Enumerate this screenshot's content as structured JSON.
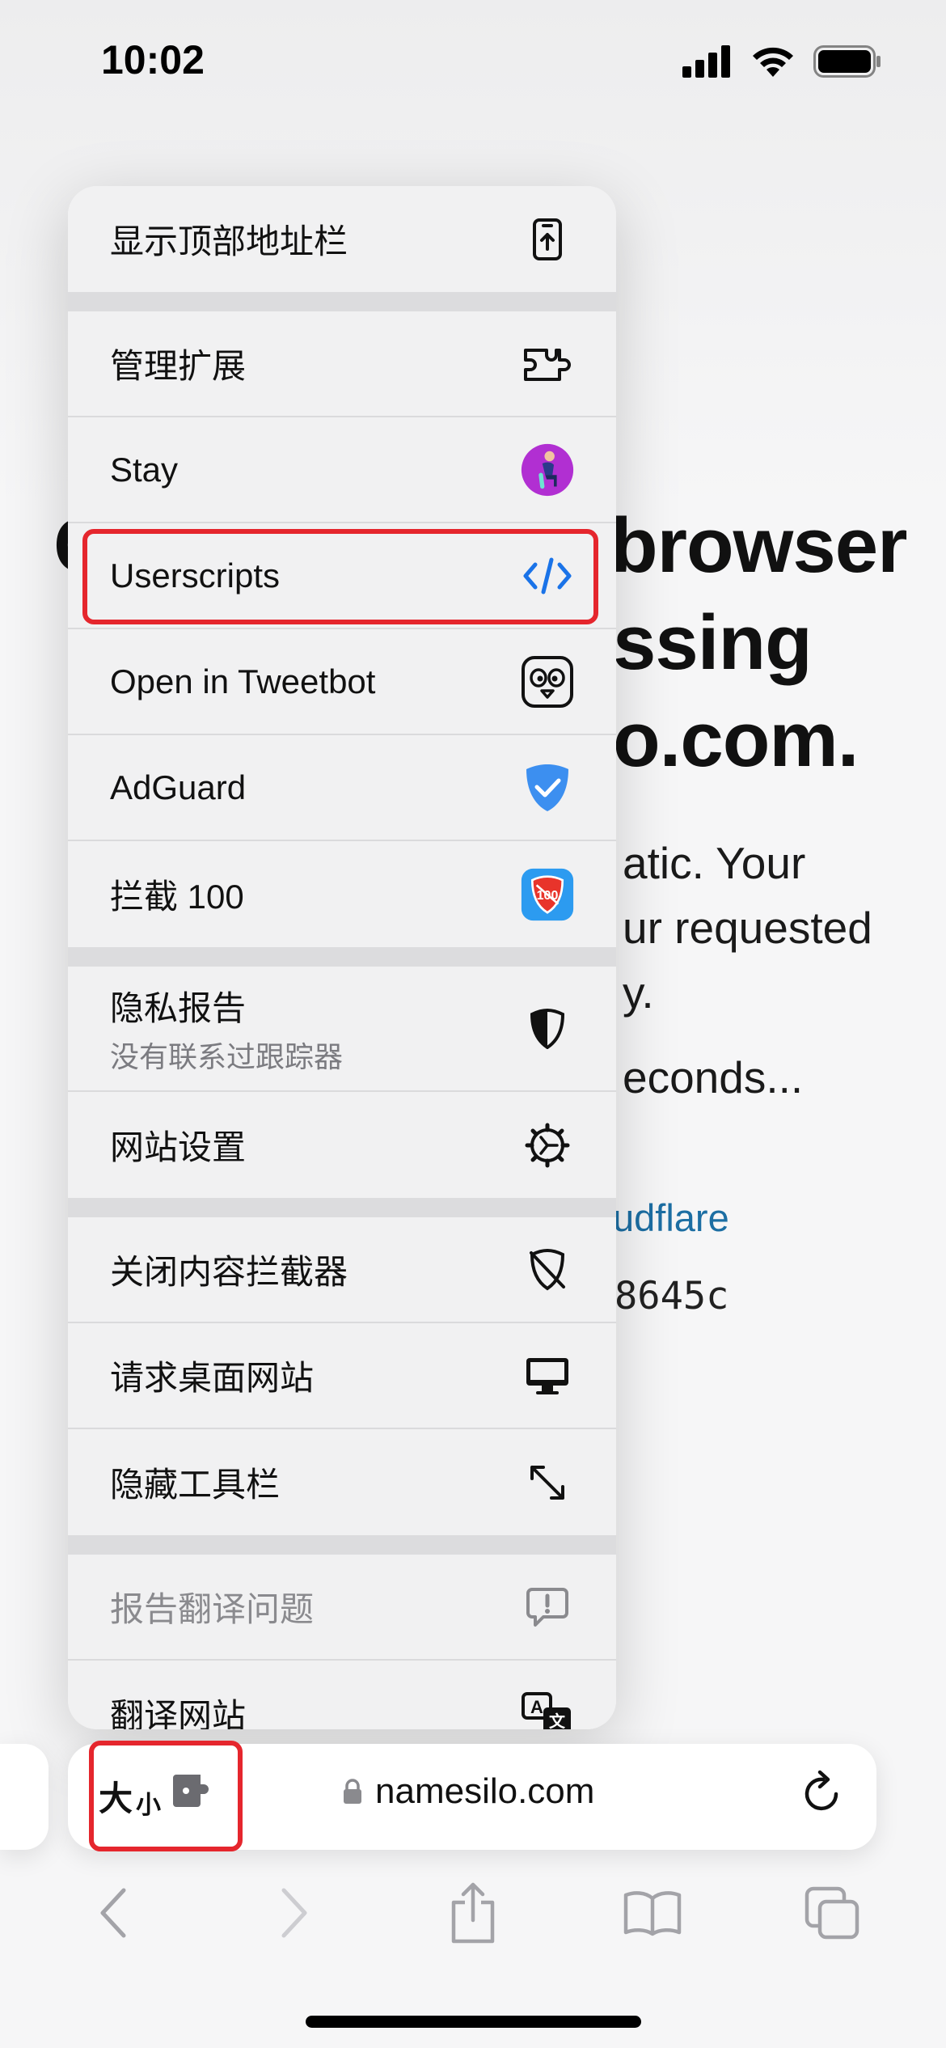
{
  "status_bar": {
    "time": "10:02"
  },
  "background_page": {
    "heading_lines": [
      "Checking your browser",
      "before accessing",
      "namesilo.com."
    ],
    "heading_visible": [
      "C",
      "browser",
      "ssing",
      "o.com."
    ],
    "para_visible": [
      "atic. Your",
      "ur requested",
      "y.",
      "econds..."
    ],
    "link_visible": "udflare",
    "ray_visible": "8645c"
  },
  "menu": {
    "sections": [
      [
        {
          "name": "show-top-address-bar",
          "label": "显示顶部地址栏",
          "icon": "phone-arrow-up-icon"
        }
      ],
      [
        {
          "name": "manage-extensions",
          "label": "管理扩展",
          "icon": "puzzle-icon"
        },
        {
          "name": "stay",
          "label": "Stay",
          "icon": "stay-app-icon"
        },
        {
          "name": "userscripts",
          "label": "Userscripts",
          "icon": "code-brackets-icon"
        },
        {
          "name": "open-in-tweetbot",
          "label": "Open in Tweetbot",
          "icon": "tweetbot-icon"
        },
        {
          "name": "adguard",
          "label": "AdGuard",
          "icon": "adguard-shield-icon"
        },
        {
          "name": "block-100",
          "label": "拦截 100",
          "icon": "block100-app-icon"
        }
      ],
      [
        {
          "name": "privacy-report",
          "label": "隐私报告",
          "sublabel": "没有联系过跟踪器",
          "icon": "half-shield-icon"
        },
        {
          "name": "website-settings",
          "label": "网站设置",
          "icon": "gear-icon"
        }
      ],
      [
        {
          "name": "turn-off-content-blockers",
          "label": "关闭内容拦截器",
          "icon": "shield-slash-icon"
        },
        {
          "name": "request-desktop-website",
          "label": "请求桌面网站",
          "icon": "desktop-icon"
        },
        {
          "name": "hide-toolbar",
          "label": "隐藏工具栏",
          "icon": "expand-arrows-icon"
        }
      ],
      [
        {
          "name": "report-translation-issue",
          "label": "报告翻译问题",
          "icon": "exclamation-bubble-icon",
          "disabled": true
        },
        {
          "name": "translate-website",
          "label": "翻译网站",
          "icon": "translate-icon"
        }
      ]
    ]
  },
  "address_bar": {
    "aa_big": "大",
    "aa_small": "小",
    "url": "namesilo.com",
    "lock_icon": "lock-icon",
    "reload_icon": "reload-icon"
  },
  "toolbar": {
    "items": [
      "back-icon",
      "forward-icon",
      "share-icon",
      "bookmarks-icon",
      "tabs-icon"
    ]
  },
  "colors": {
    "highlight": "#e5262d",
    "accent_blue": "#1a73e8",
    "link": "#1c6ea3"
  }
}
